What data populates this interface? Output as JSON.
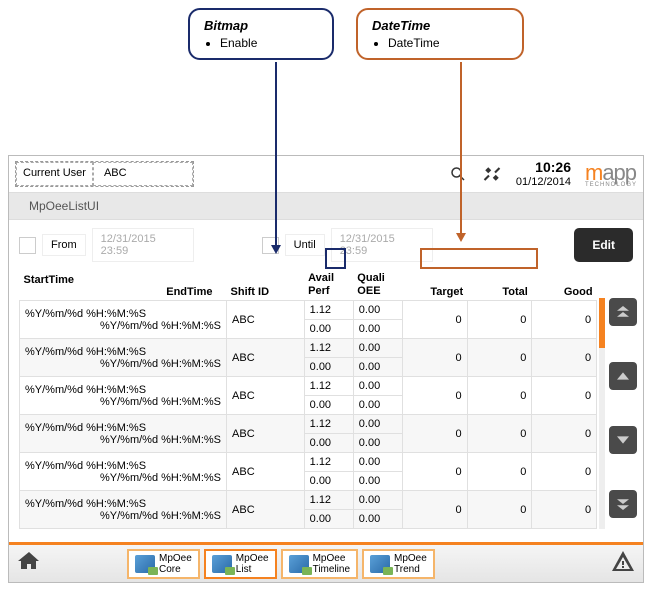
{
  "callouts": {
    "bitmap": {
      "title": "Bitmap",
      "item": "Enable"
    },
    "datetime": {
      "title": "DateTime",
      "item": "DateTime"
    }
  },
  "topbar": {
    "currentUserLabel": "Current User",
    "currentUserValue": "ABC",
    "time": "10:26",
    "date": "01/12/2014"
  },
  "logo": {
    "m": "m",
    "rest": "app",
    "sub": "TECHNOLOGY"
  },
  "title": "MpOeeListUI",
  "filter": {
    "fromLabel": "From",
    "fromValue": "12/31/2015 23:59",
    "untilLabel": "Until",
    "untilValue": "12/31/2015 23:59",
    "editLabel": "Edit"
  },
  "headers": {
    "startTime": "StartTime",
    "endTime": "EndTime",
    "shiftId": "Shift ID",
    "availPerf1": "Avail",
    "availPerf2": "Perf",
    "qualiOee1": "Quali",
    "qualiOee2": "OEE",
    "target": "Target",
    "total": "Total",
    "good": "Good"
  },
  "rows": [
    {
      "start": "%Y/%m/%d %H:%M:%S",
      "end": "%Y/%m/%d %H:%M:%S",
      "shift": "ABC",
      "a": "1.12",
      "b": "0.00",
      "c": "0.00",
      "d": "0.00",
      "t": "0",
      "tot": "0",
      "g": "0"
    },
    {
      "start": "%Y/%m/%d %H:%M:%S",
      "end": "%Y/%m/%d %H:%M:%S",
      "shift": "ABC",
      "a": "1.12",
      "b": "0.00",
      "c": "0.00",
      "d": "0.00",
      "t": "0",
      "tot": "0",
      "g": "0"
    },
    {
      "start": "%Y/%m/%d %H:%M:%S",
      "end": "%Y/%m/%d %H:%M:%S",
      "shift": "ABC",
      "a": "1.12",
      "b": "0.00",
      "c": "0.00",
      "d": "0.00",
      "t": "0",
      "tot": "0",
      "g": "0"
    },
    {
      "start": "%Y/%m/%d %H:%M:%S",
      "end": "%Y/%m/%d %H:%M:%S",
      "shift": "ABC",
      "a": "1.12",
      "b": "0.00",
      "c": "0.00",
      "d": "0.00",
      "t": "0",
      "tot": "0",
      "g": "0"
    },
    {
      "start": "%Y/%m/%d %H:%M:%S",
      "end": "%Y/%m/%d %H:%M:%S",
      "shift": "ABC",
      "a": "1.12",
      "b": "0.00",
      "c": "0.00",
      "d": "0.00",
      "t": "0",
      "tot": "0",
      "g": "0"
    },
    {
      "start": "%Y/%m/%d %H:%M:%S",
      "end": "%Y/%m/%d %H:%M:%S",
      "shift": "ABC",
      "a": "1.12",
      "b": "0.00",
      "c": "0.00",
      "d": "0.00",
      "t": "0",
      "tot": "0",
      "g": "0"
    }
  ],
  "tabs": [
    {
      "l1": "MpOee",
      "l2": "Core"
    },
    {
      "l1": "MpOee",
      "l2": "List"
    },
    {
      "l1": "MpOee",
      "l2": "Timeline"
    },
    {
      "l1": "MpOee",
      "l2": "Trend"
    }
  ]
}
